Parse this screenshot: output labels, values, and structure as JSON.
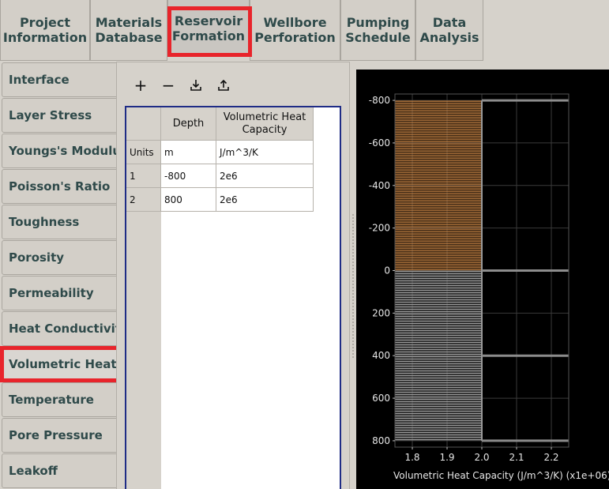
{
  "top_tabs": [
    {
      "line1": "Project",
      "line2": "Information"
    },
    {
      "line1": "Materials",
      "line2": "Database"
    },
    {
      "line1": "Reservoir",
      "line2": "Formation"
    },
    {
      "line1": "Wellbore",
      "line2": "Perforation"
    },
    {
      "line1": "Pumping",
      "line2": "Schedule"
    },
    {
      "line1": "Data",
      "line2": "Analysis"
    }
  ],
  "side_tabs": [
    "Interface",
    "Layer Stress",
    "Youngs's Modulus",
    "Poisson's Ratio",
    "Toughness",
    "Porosity",
    "Permeability",
    "Heat Conductivity",
    "Volumetric Heat C",
    "Temperature",
    "Pore Pressure",
    "Leakoff"
  ],
  "toolbar": {
    "add": "+",
    "remove": "−",
    "import_icon": "import-icon",
    "export_icon": "export-icon"
  },
  "table": {
    "headers": [
      "Depth",
      "Volumetric Heat Capacity"
    ],
    "units_label": "Units",
    "units": [
      "m",
      "J/m^3/K"
    ],
    "rows": [
      {
        "index": "1",
        "depth": "-800",
        "value": "2e6"
      },
      {
        "index": "2",
        "depth": "800",
        "value": "2e6"
      }
    ]
  },
  "colors": {
    "highlight": "#e8242b",
    "tab_text": "#2f4a4a",
    "upper_layer": "#c98545",
    "lower_layer": "#9a9a9a",
    "chart_bg": "#000000"
  },
  "chart_data": {
    "type": "bar",
    "orientation": "horizontal-bands",
    "xlabel": "Volumetric Heat Capacity (J/m^3/K) (x1e+06)",
    "ylabel": "",
    "x_ticks": [
      "1.8",
      "1.9",
      "2.0",
      "2.1",
      "2.2"
    ],
    "y_ticks": [
      "-800",
      "-600",
      "-400",
      "-200",
      "0",
      "200",
      "400",
      "600",
      "800"
    ],
    "xlim": [
      1.75,
      2.25
    ],
    "ylim": [
      -830,
      830
    ],
    "y_inverted": true,
    "bands": [
      {
        "depth_from": -800,
        "depth_to": 0,
        "value": 2.0,
        "color": "#c98545"
      },
      {
        "depth_from": 0,
        "depth_to": 800,
        "value": 2.0,
        "color": "#9a9a9a"
      }
    ],
    "interfaces": [
      -800,
      0,
      400,
      800
    ]
  }
}
